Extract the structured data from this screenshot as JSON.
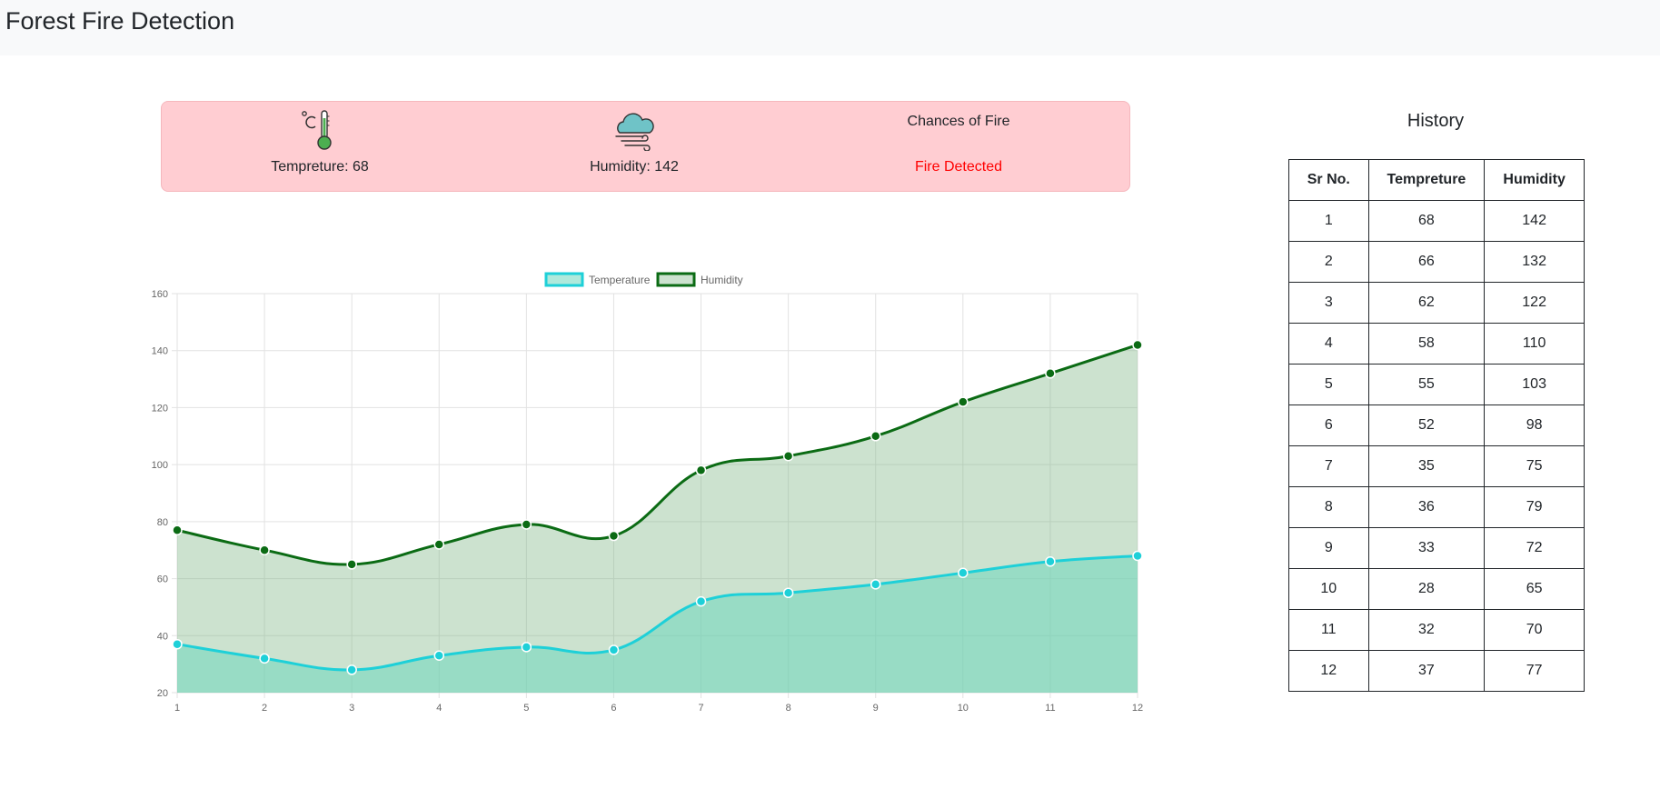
{
  "app": {
    "title": "Forest Fire Detection"
  },
  "status": {
    "temperature_label": "Tempreture: 68",
    "humidity_label": "Humidity: 142",
    "chance_heading": "Chances of Fire",
    "chance_value": "Fire Detected",
    "alert_color": "#ff0000",
    "card_color": "#ffcdd2"
  },
  "history": {
    "title": "History",
    "columns": [
      "Sr No.",
      "Tempreture",
      "Humidity"
    ],
    "rows": [
      [
        "1",
        "68",
        "142"
      ],
      [
        "2",
        "66",
        "132"
      ],
      [
        "3",
        "62",
        "122"
      ],
      [
        "4",
        "58",
        "110"
      ],
      [
        "5",
        "55",
        "103"
      ],
      [
        "6",
        "52",
        "98"
      ],
      [
        "7",
        "35",
        "75"
      ],
      [
        "8",
        "36",
        "79"
      ],
      [
        "9",
        "33",
        "72"
      ],
      [
        "10",
        "28",
        "65"
      ],
      [
        "11",
        "32",
        "70"
      ],
      [
        "12",
        "37",
        "77"
      ]
    ]
  },
  "chart_data": {
    "type": "area",
    "x": [
      1,
      2,
      3,
      4,
      5,
      6,
      7,
      8,
      9,
      10,
      11,
      12
    ],
    "ylim": [
      20,
      160
    ],
    "yticks": [
      20,
      40,
      60,
      80,
      100,
      120,
      140,
      160
    ],
    "grid": true,
    "legend": "top-center",
    "series": [
      {
        "name": "Temperature",
        "values": [
          37,
          32,
          28,
          33,
          36,
          35,
          52,
          55,
          58,
          62,
          66,
          68
        ],
        "color": "#1ed0d8",
        "fill": "rgba(110,215,190,0.55)"
      },
      {
        "name": "Humidity",
        "values": [
          77,
          70,
          65,
          72,
          79,
          75,
          98,
          103,
          110,
          122,
          132,
          142
        ],
        "color": "#0b6b14",
        "fill": "rgba(120,180,130,0.38)"
      }
    ]
  }
}
